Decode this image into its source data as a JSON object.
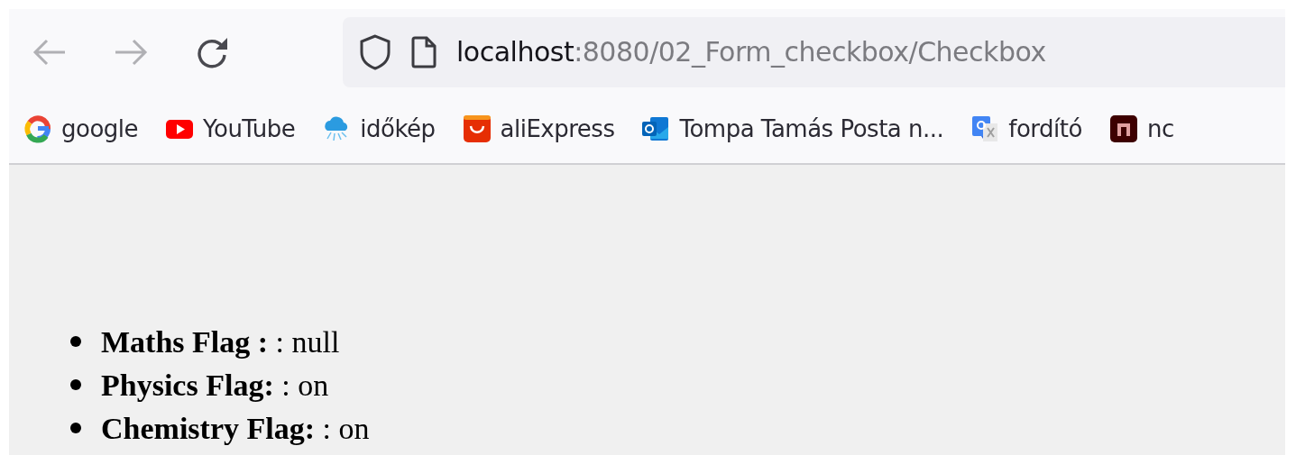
{
  "browser": {
    "address": {
      "host": "localhost",
      "path": ":8080/02_Form_checkbox/Checkbox"
    },
    "bookmarks": [
      {
        "kind": "google",
        "label": "google"
      },
      {
        "kind": "youtube",
        "label": "YouTube"
      },
      {
        "kind": "weather",
        "label": "időkép"
      },
      {
        "kind": "ali",
        "label": "aliExpress"
      },
      {
        "kind": "outlook",
        "label": "Tompa Tamás Posta n..."
      },
      {
        "kind": "translate",
        "label": "fordító"
      },
      {
        "kind": "dark",
        "label": "nc"
      }
    ]
  },
  "list": [
    "**Maths Flag :** : null",
    "**Physics Flag:** : on",
    "**Chemistry Flag:** : on"
  ]
}
